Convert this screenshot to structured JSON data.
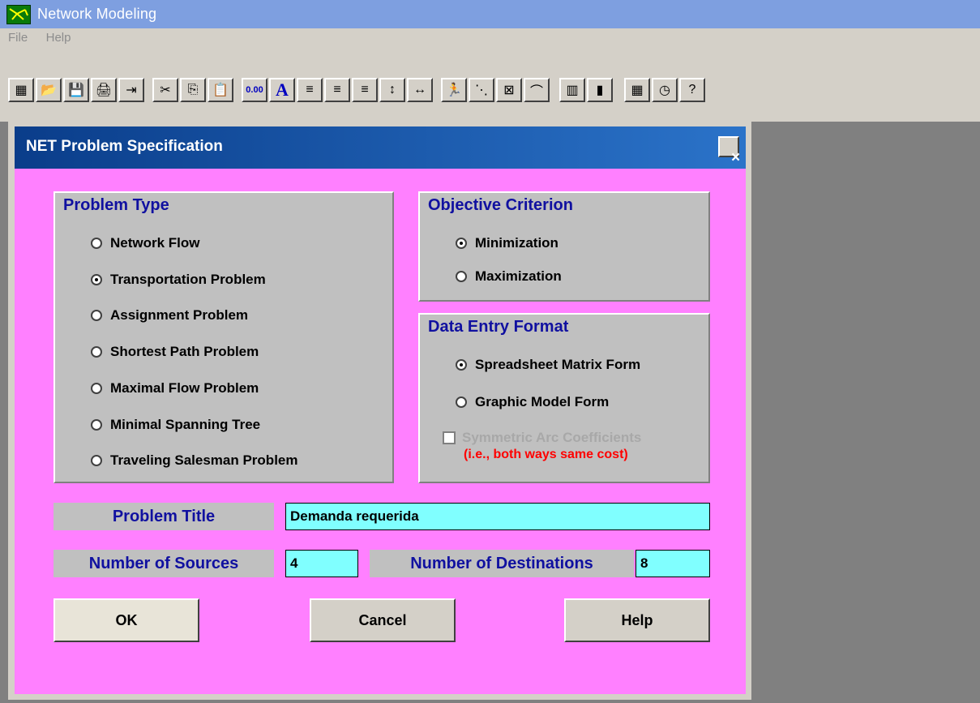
{
  "window": {
    "title": "Network Modeling"
  },
  "menu": [
    {
      "label": "File"
    },
    {
      "label": "Help"
    }
  ],
  "toolbar": {
    "buttons": [
      {
        "name": "grid-icon",
        "glyph": "▦"
      },
      {
        "name": "open-folder-icon",
        "glyph": "📂"
      },
      {
        "name": "save-icon",
        "glyph": "💾"
      },
      {
        "name": "print-icon",
        "glyph": "🖨"
      },
      {
        "name": "exit-door-icon",
        "glyph": "⇥"
      },
      {
        "name": "cut-icon",
        "glyph": "✂"
      },
      {
        "name": "copy-icon",
        "glyph": "⎘"
      },
      {
        "name": "paste-icon",
        "glyph": "📋"
      },
      {
        "name": "decimal-format-icon",
        "glyph": "0.00"
      },
      {
        "name": "font-icon",
        "glyph": "A"
      },
      {
        "name": "align-left-icon",
        "glyph": "≡"
      },
      {
        "name": "align-center-icon",
        "glyph": "≡"
      },
      {
        "name": "align-right-icon",
        "glyph": "≡"
      },
      {
        "name": "column-height-icon",
        "glyph": "↕"
      },
      {
        "name": "column-width-icon",
        "glyph": "↔"
      },
      {
        "name": "solve-person-icon",
        "glyph": "🏃"
      },
      {
        "name": "node-layout-icon",
        "glyph": "⋱"
      },
      {
        "name": "network-graph-icon",
        "glyph": "⊠"
      },
      {
        "name": "curve-icon",
        "glyph": "⌒"
      },
      {
        "name": "matrix-view-icon",
        "glyph": "▥"
      },
      {
        "name": "bar-chart-icon",
        "glyph": "▮"
      },
      {
        "name": "calculator-icon",
        "glyph": "▦"
      },
      {
        "name": "clock-icon",
        "glyph": "◷"
      },
      {
        "name": "help-question-icon",
        "glyph": "?"
      }
    ]
  },
  "dialog": {
    "title": "NET Problem Specification",
    "close_label": "×",
    "problem_type": {
      "title": "Problem Type",
      "options": [
        {
          "label": "Network Flow",
          "selected": false
        },
        {
          "label": "Transportation Problem",
          "selected": true
        },
        {
          "label": "Assignment Problem",
          "selected": false
        },
        {
          "label": "Shortest Path Problem",
          "selected": false
        },
        {
          "label": "Maximal Flow Problem",
          "selected": false
        },
        {
          "label": "Minimal Spanning Tree",
          "selected": false
        },
        {
          "label": "Traveling Salesman Problem",
          "selected": false
        }
      ]
    },
    "objective": {
      "title": "Objective Criterion",
      "options": [
        {
          "label": "Minimization",
          "selected": true
        },
        {
          "label": "Maximization",
          "selected": false
        }
      ]
    },
    "data_entry": {
      "title": "Data Entry Format",
      "options": [
        {
          "label": "Spreadsheet Matrix Form",
          "selected": true
        },
        {
          "label": "Graphic Model Form",
          "selected": false
        }
      ],
      "symmetric_label": "Symmetric Arc Coefficients",
      "symmetric_note": "(i.e., both ways same cost)",
      "symmetric_checked": false
    },
    "problem_title_label": "Problem Title",
    "problem_title_value": "Demanda requerida",
    "sources_label": "Number of Sources",
    "sources_value": "4",
    "destinations_label": "Number of Destinations",
    "destinations_value": "8",
    "buttons": {
      "ok": "OK",
      "cancel": "Cancel",
      "help": "Help"
    }
  },
  "colors": {
    "dialog_bg": "#ff80ff",
    "field_bg": "#80ffff",
    "group_title": "#1010a0",
    "note_red": "#ff0000"
  }
}
